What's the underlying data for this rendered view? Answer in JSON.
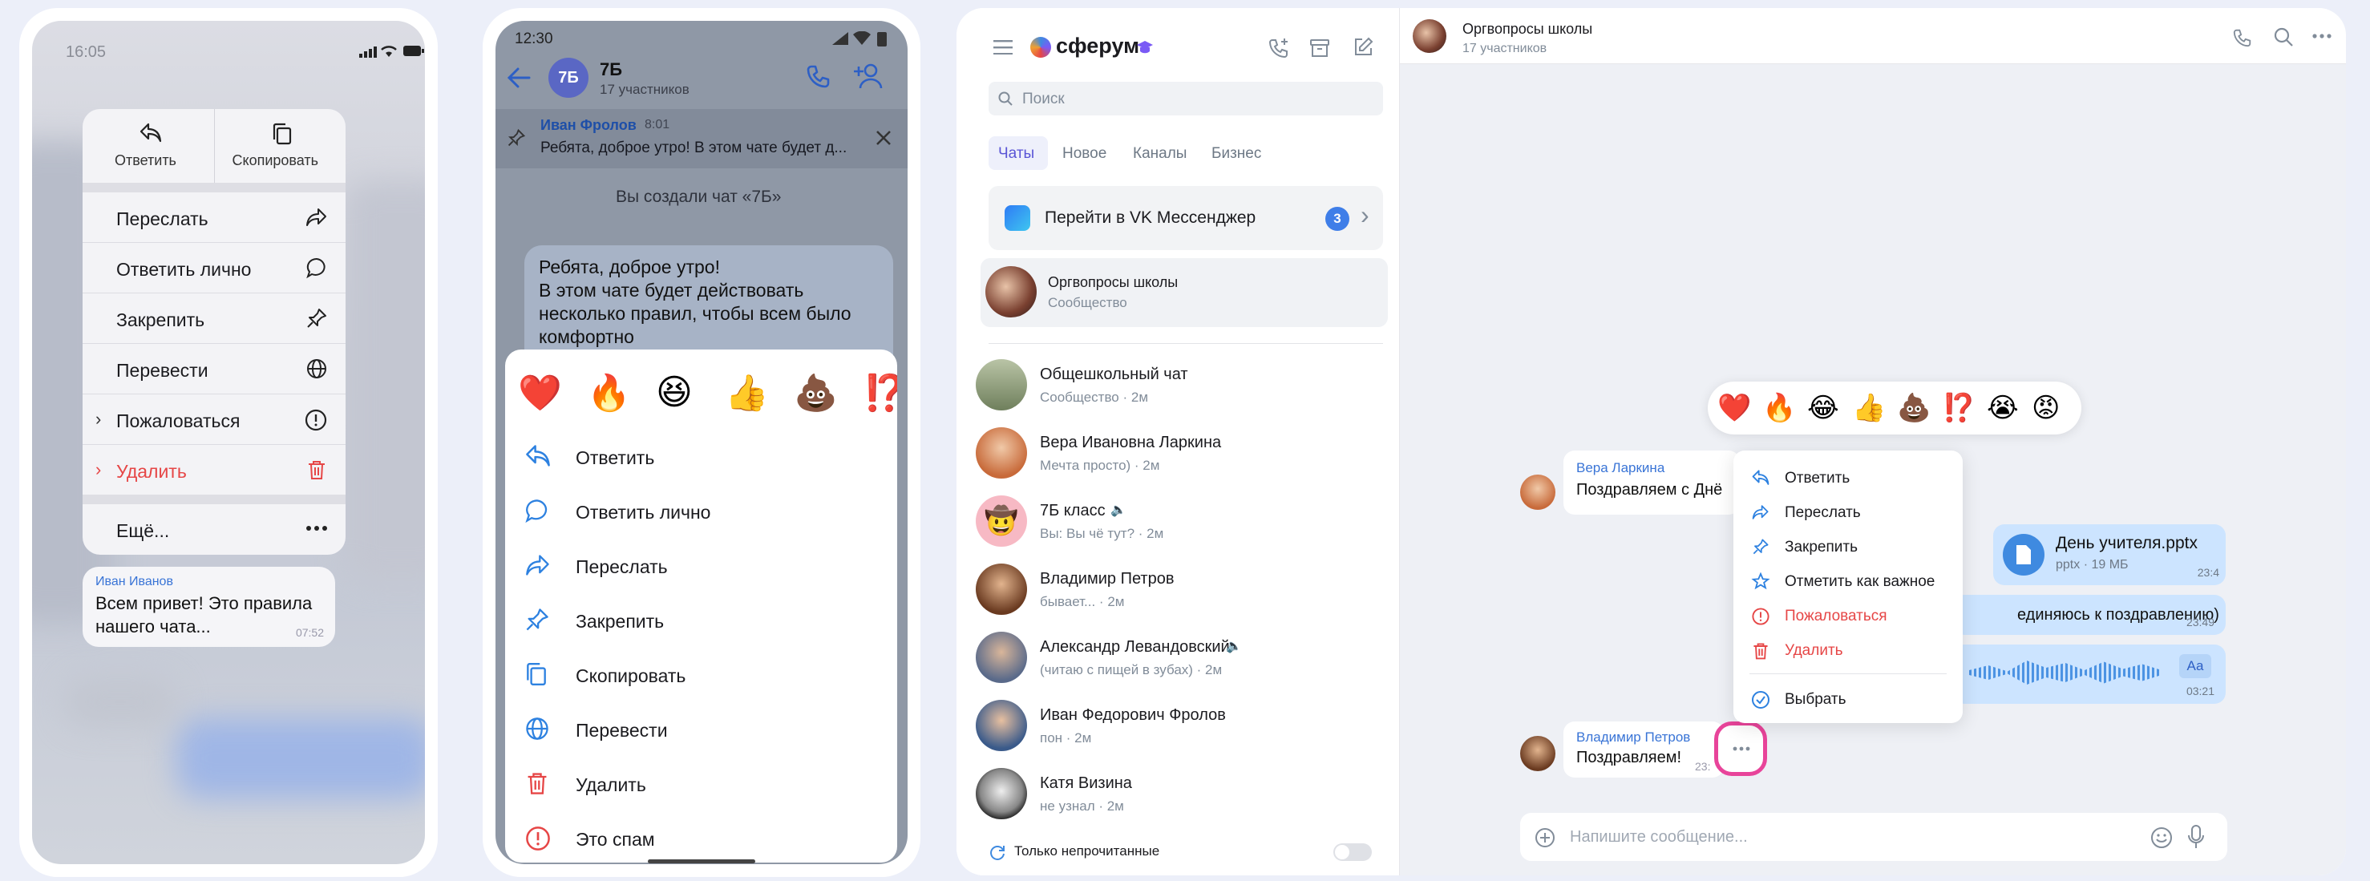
{
  "colors": {
    "accent": "#2d81e0",
    "danger": "#e64646",
    "highlight": "#e8449a",
    "tag": "#3974d6"
  },
  "phone1": {
    "time": "16:05",
    "top_actions": [
      {
        "label": "Ответить",
        "icon": "reply-icon"
      },
      {
        "label": "Скопировать",
        "icon": "copy-icon"
      }
    ],
    "items": [
      {
        "label": "Переслать",
        "icon": "forward-icon"
      },
      {
        "label": "Ответить лично",
        "icon": "comment-icon"
      },
      {
        "label": "Закрепить",
        "icon": "pin-icon"
      },
      {
        "label": "Перевести",
        "icon": "globe-icon"
      },
      {
        "label": "Пожаловаться",
        "icon": "warning-icon"
      },
      {
        "label": "Удалить",
        "icon": "trash-icon",
        "danger": true
      },
      {
        "label": "Ещё...",
        "icon": "more-icon"
      }
    ],
    "message": {
      "author": "Иван Иванов",
      "text_line1": "Всем привет! Это правила",
      "text_line2": "нашего чата...",
      "time": "07:52"
    }
  },
  "phone2": {
    "time": "12:30",
    "chat_avatar": "7Б",
    "chat_title": "7Б",
    "chat_subtitle": "17 участников",
    "pinned": {
      "author": "Иван Фролов",
      "time": "8:01",
      "text": "Ребята, доброе утро! В этом чате будет д..."
    },
    "system": "Вы создали чат «7Б»",
    "message_lines": [
      "Ребята, доброе утро!",
      "В этом чате будет действовать",
      "несколько правил, чтобы всем было",
      "комфортно"
    ],
    "reactions": [
      "❤️",
      "🔥",
      "😆",
      "👍",
      "💩",
      "⁉️"
    ],
    "items": [
      {
        "label": "Ответить",
        "icon": "reply-icon"
      },
      {
        "label": "Ответить лично",
        "icon": "comment-icon"
      },
      {
        "label": "Переслать",
        "icon": "forward-icon"
      },
      {
        "label": "Закрепить",
        "icon": "pin-icon"
      },
      {
        "label": "Скопировать",
        "icon": "copy-icon"
      },
      {
        "label": "Перевести",
        "icon": "globe-icon"
      },
      {
        "label": "Удалить",
        "icon": "trash-icon"
      },
      {
        "label": "Это спам",
        "icon": "warning-icon"
      }
    ]
  },
  "desktop": {
    "brand": "сферум",
    "search_placeholder": "Поиск",
    "tabs": [
      "Чаты",
      "Новое",
      "Каналы",
      "Бизнес"
    ],
    "vk_banner": {
      "label": "Перейти в VK Мессенджер",
      "count": "3"
    },
    "active_chat": {
      "name": "Оргвопросы школы",
      "sub": "Сообщество"
    },
    "chats": [
      {
        "name": "Общешкольный чат",
        "sub": "Сообщество · 2м"
      },
      {
        "name": "Вера Ивановна Ларкина",
        "sub": "Мечта просто) · 2м"
      },
      {
        "name": "7Б класс",
        "sub": "Вы: Вы чё тут? · 2м"
      },
      {
        "name": "Владимир Петров",
        "sub": "бывает... · 2м"
      },
      {
        "name": "Александр Левандовский",
        "sub": "(читаю с пищей в зубах) · 2м"
      },
      {
        "name": "Иван Федорович Фролов",
        "sub": "пон · 2м"
      },
      {
        "name": "Катя Визина",
        "sub": "не узнал · 2м"
      }
    ],
    "unread_only": "Только непрочитанные",
    "header": {
      "title": "Оргвопросы школы",
      "subtitle": "17 участников"
    },
    "reactions": [
      "❤️",
      "🔥",
      "😂",
      "👍",
      "💩",
      "⁉️",
      "😭",
      "😡"
    ],
    "msg1": {
      "author": "Вера Ларкина",
      "text": "Поздравляем с Днё"
    },
    "file": {
      "name": "День учителя.pptx",
      "meta": "pptx · 19 МБ",
      "time": "23:4"
    },
    "msg_partial": {
      "text": "единяюсь к поздравлению)",
      "time": "23:49"
    },
    "voice": {
      "badge": "Аа",
      "time": "03:21"
    },
    "msg2": {
      "author": "Владимир Петров",
      "text": "Поздравляем!",
      "time": "23:"
    },
    "menu": [
      {
        "label": "Ответить",
        "icon": "reply-icon"
      },
      {
        "label": "Переслать",
        "icon": "forward-icon"
      },
      {
        "label": "Закрепить",
        "icon": "pin-icon"
      },
      {
        "label": "Отметить как важное",
        "icon": "star-icon"
      },
      {
        "label": "Пожаловаться",
        "icon": "warning-icon",
        "danger": true
      },
      {
        "label": "Удалить",
        "icon": "trash-icon",
        "danger": true
      },
      {
        "label": "Выбрать",
        "icon": "check-circle-icon"
      }
    ],
    "composer_placeholder": "Напишите сообщение..."
  }
}
